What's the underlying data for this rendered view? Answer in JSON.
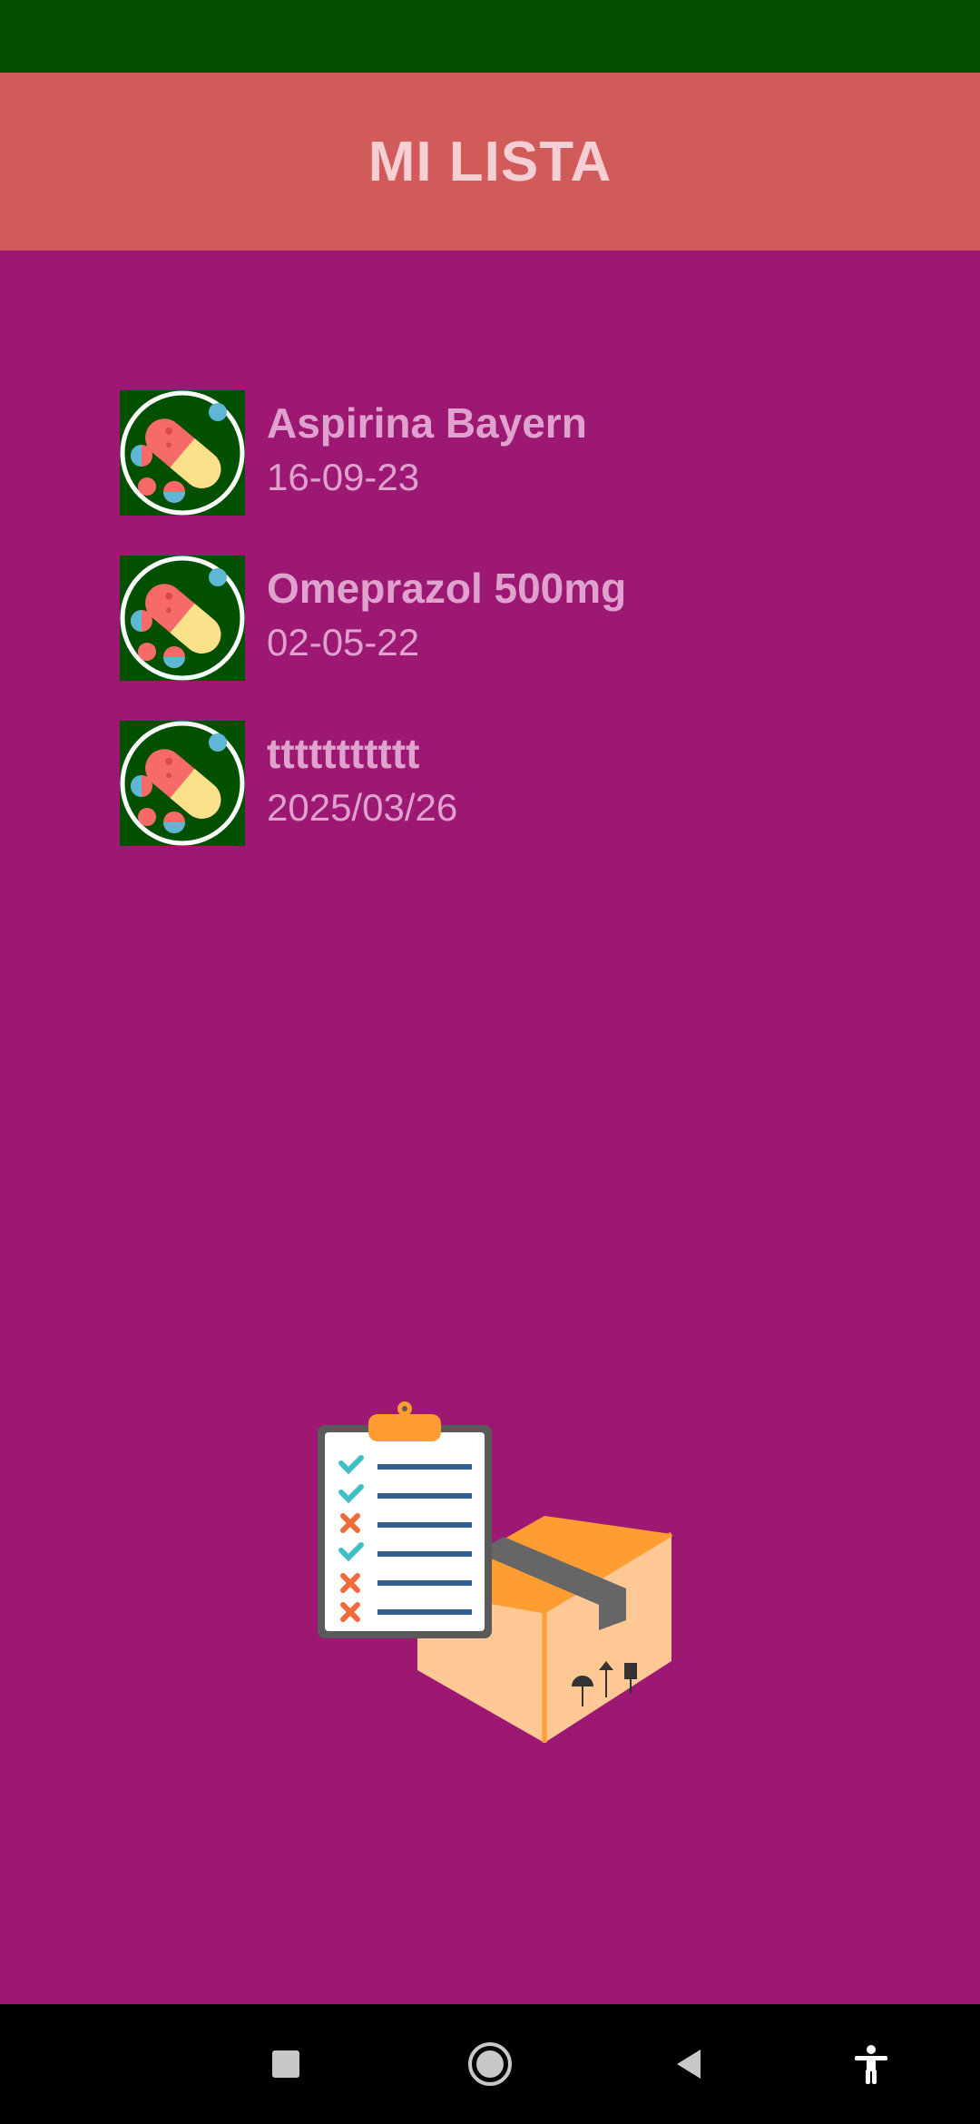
{
  "header": {
    "title": "MI LISTA"
  },
  "items": [
    {
      "name": "Aspirina Bayern",
      "date": "16-09-23"
    },
    {
      "name": "Omeprazol 500mg",
      "date": "02-05-22"
    },
    {
      "name": "ttttttttttt",
      "date": "2025/03/26"
    }
  ],
  "icons": {
    "item": "pills-icon",
    "illustration": "checklist-box-illustration",
    "nav": [
      "recents-square-icon",
      "home-circle-icon",
      "back-triangle-icon",
      "accessibility-icon"
    ]
  },
  "colors": {
    "statusbar": "#005000",
    "header": "#d15a5a",
    "background": "#9c1872",
    "text": "#dfa1cd"
  }
}
